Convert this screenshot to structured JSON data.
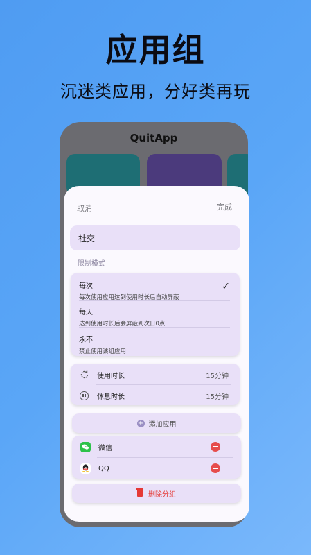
{
  "headline": "应用组",
  "subline": "沉迷类应用，分好类再玩",
  "app": {
    "title": "QuitApp"
  },
  "sheet": {
    "cancel": "取消",
    "done": "完成",
    "group_name": "社交",
    "limit_mode_label": "限制模式",
    "modes": [
      {
        "title": "每次",
        "desc": "每次使用应用达到使用时长后自动屏蔽",
        "selected": true
      },
      {
        "title": "每天",
        "desc": "达到使用时长后会屏蔽到次日0点",
        "selected": false
      },
      {
        "title": "永不",
        "desc": "禁止使用该组应用",
        "selected": false
      }
    ],
    "usage": {
      "label": "使用时长",
      "value": "15分钟",
      "icon": "refresh-icon"
    },
    "rest": {
      "label": "休息时长",
      "value": "15分钟",
      "icon": "pause-icon"
    },
    "add_app": "添加应用",
    "apps": [
      {
        "name": "微信",
        "icon": "wechat-icon"
      },
      {
        "name": "QQ",
        "icon": "qq-icon"
      }
    ],
    "delete_group": "删除分组"
  },
  "colors": {
    "accent": "#9b8fc4",
    "danger": "#e53935",
    "sheet_bg": "#fbf9fe",
    "card_bg": "#e9e0f8"
  }
}
